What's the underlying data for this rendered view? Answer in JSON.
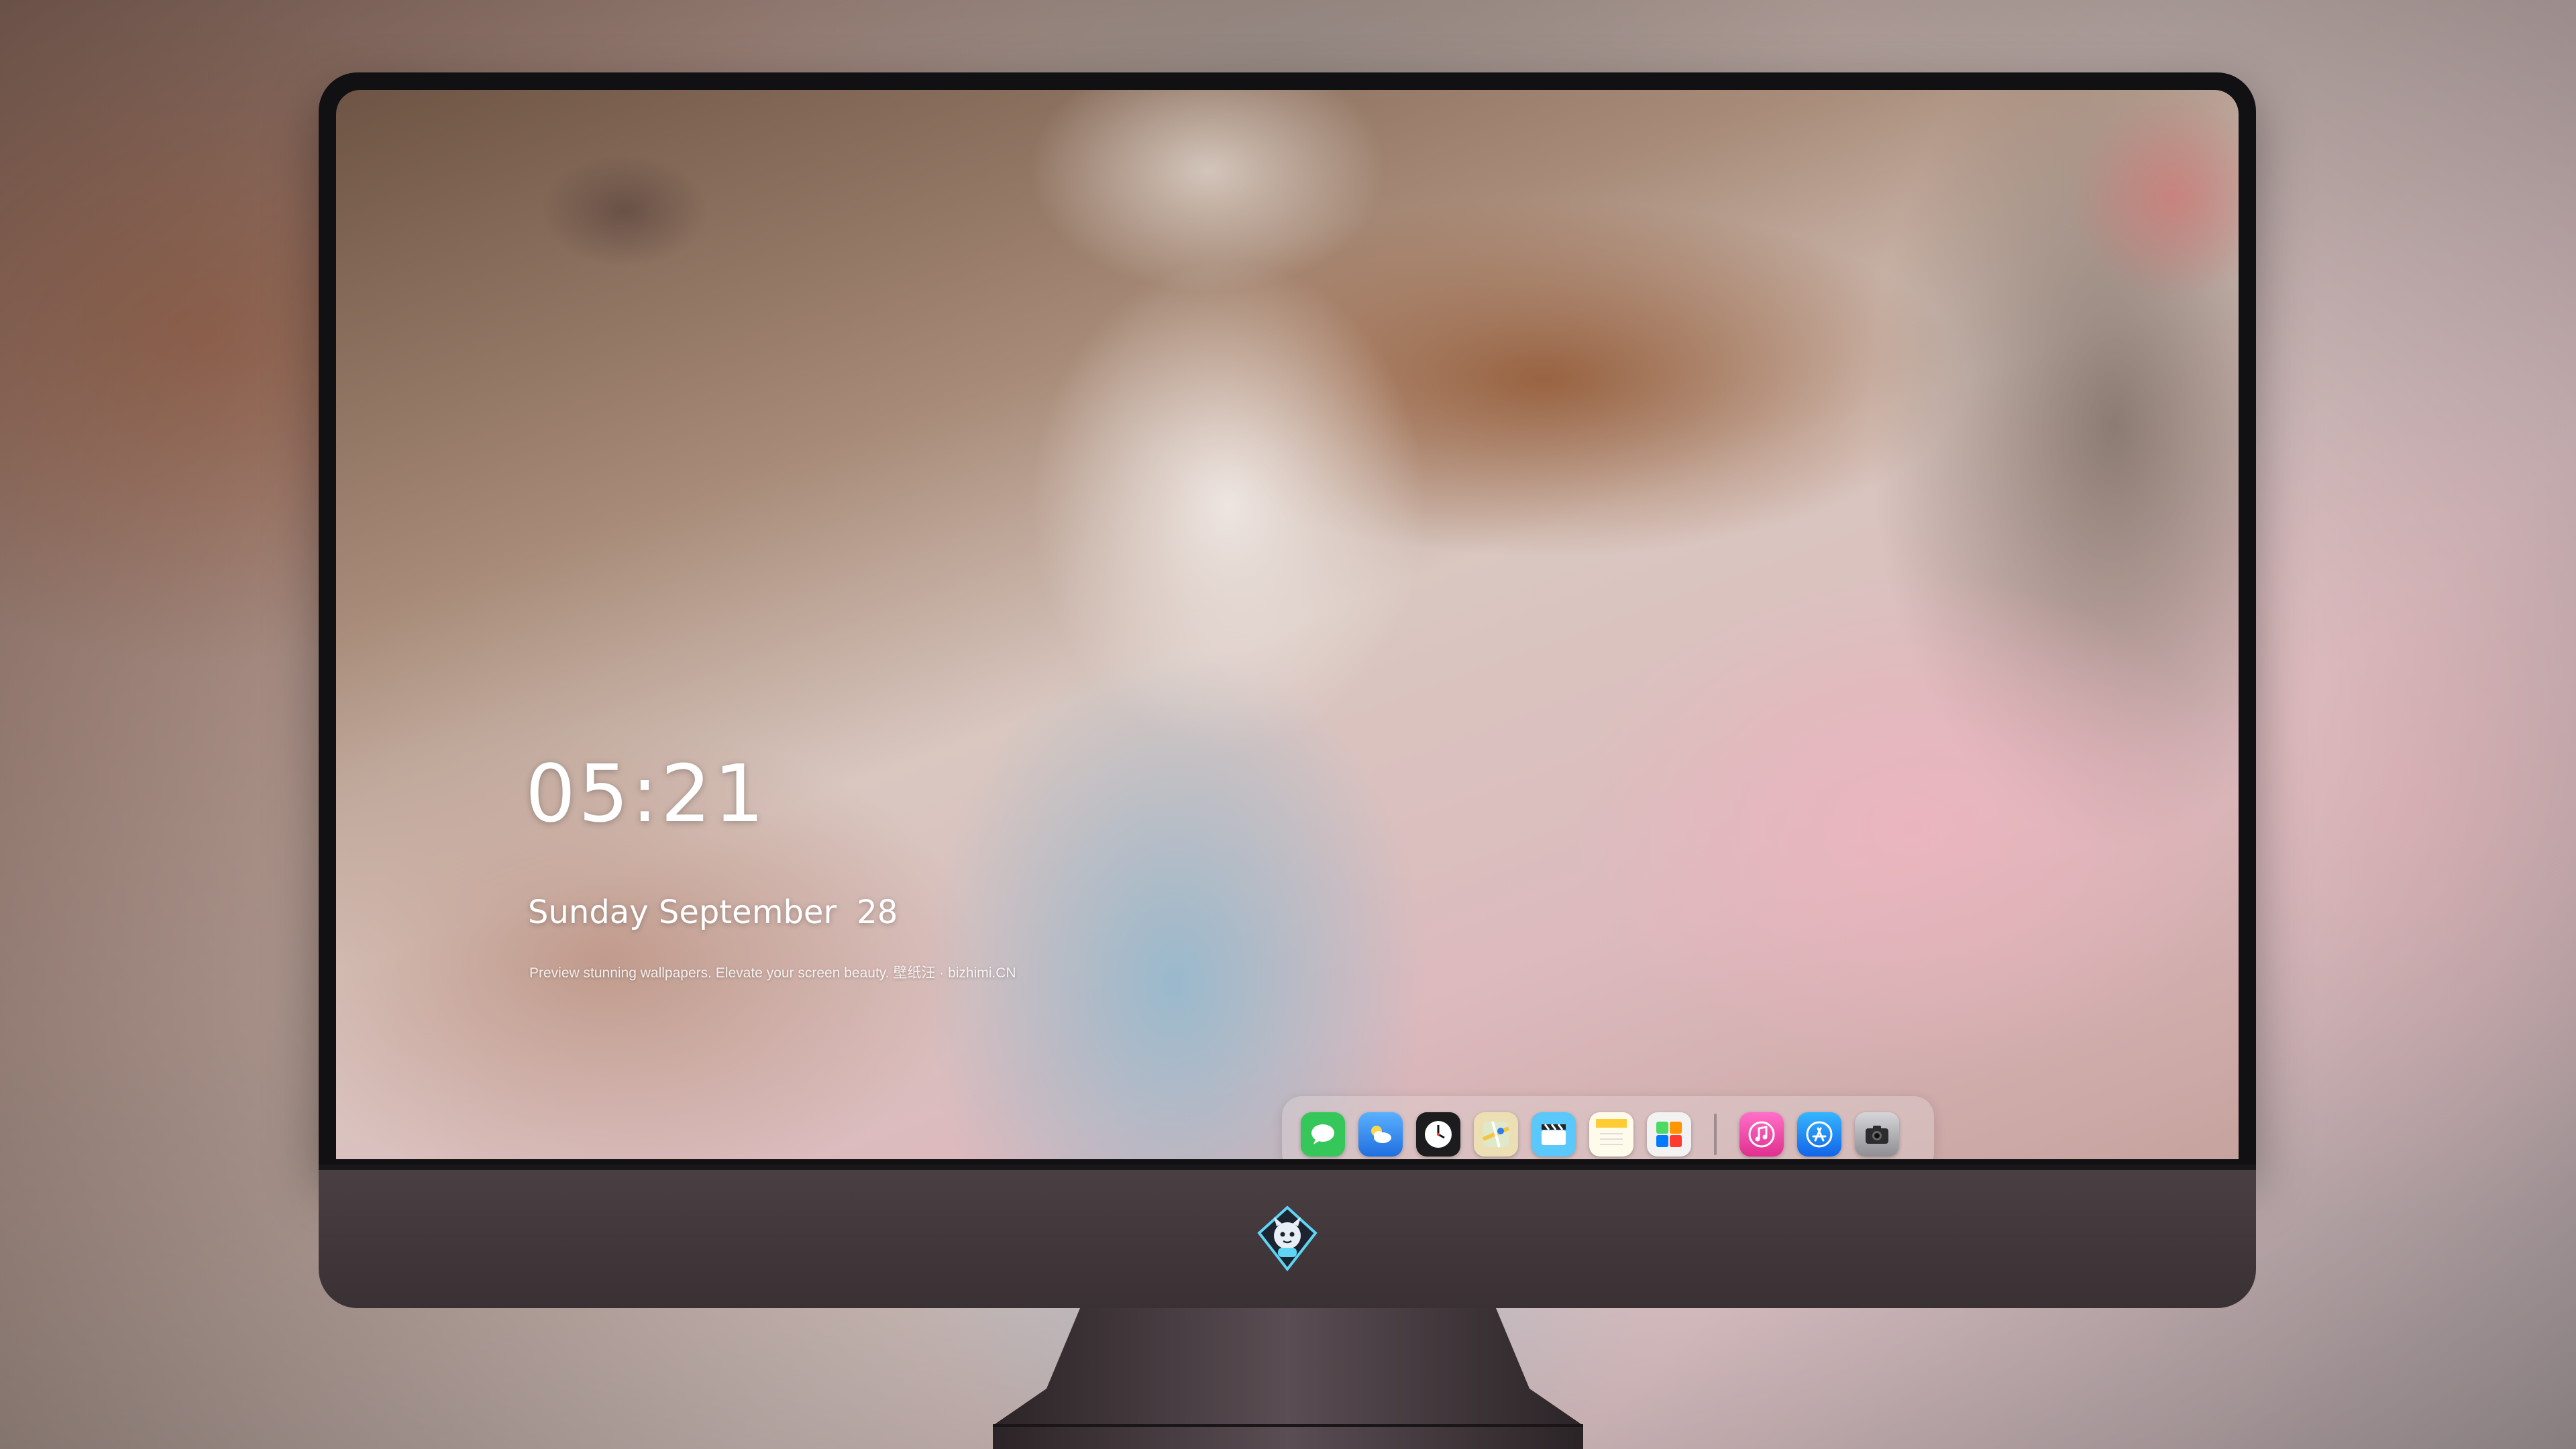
{
  "lockscreen": {
    "time": "05:21",
    "weekday": "Sunday",
    "month": "September",
    "day": "28",
    "promo": "Preview stunning wallpapers. Elevate your screen beauty. 壁纸汪 · bizhimi.CN"
  },
  "dock": {
    "apps": [
      {
        "name": "Messages",
        "icon": "messages-icon",
        "color": "#35c759"
      },
      {
        "name": "Weather",
        "icon": "weather-icon",
        "color": "#2f8cf0"
      },
      {
        "name": "Clock",
        "icon": "clock-icon",
        "color": "#1c1c1e"
      },
      {
        "name": "Maps",
        "icon": "maps-icon",
        "color": "#e9d9a8"
      },
      {
        "name": "Clips",
        "icon": "clapperboard-icon",
        "color": "#5ac8fa"
      },
      {
        "name": "Notes",
        "icon": "notes-icon",
        "color": "#ffd54a"
      },
      {
        "name": "Photos",
        "icon": "photos-grid-icon",
        "color": "#f0f0f0"
      },
      {
        "name": "Music",
        "icon": "music-icon",
        "color": "#fa3ea8"
      },
      {
        "name": "App Store",
        "icon": "app-store-icon",
        "color": "#1d8cf8"
      },
      {
        "name": "Camera",
        "icon": "camera-icon",
        "color": "#8e8e93"
      }
    ]
  },
  "monitor": {
    "brand_logo": "mascot-logo-icon"
  }
}
